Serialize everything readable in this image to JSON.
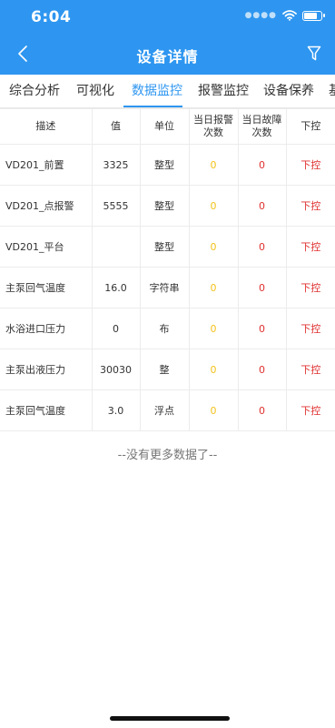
{
  "status": {
    "time": "6:04"
  },
  "nav": {
    "title": "设备详情"
  },
  "tabs": [
    "综合分析",
    "可视化",
    "数据监控",
    "报警监控",
    "设备保养",
    "基"
  ],
  "table": {
    "headers": [
      "描述",
      "值",
      "单位",
      "当日报警次数",
      "当日故障次数",
      "下控"
    ],
    "rows": [
      {
        "desc": "VD201_前置",
        "value": "3325",
        "unit": "整型",
        "alarm": "0",
        "fault": "0",
        "ctrl": "下控"
      },
      {
        "desc": "VD201_点报警",
        "value": "5555",
        "unit": "整型",
        "alarm": "0",
        "fault": "0",
        "ctrl": "下控"
      },
      {
        "desc": "VD201_平台",
        "value": "",
        "unit": "整型",
        "alarm": "0",
        "fault": "0",
        "ctrl": "下控"
      },
      {
        "desc": "主泵回气温度",
        "value": "16.0",
        "unit": "字符串",
        "alarm": "0",
        "fault": "0",
        "ctrl": "下控"
      },
      {
        "desc": "水浴进口压力",
        "value": "0",
        "unit": "布",
        "alarm": "0",
        "fault": "0",
        "ctrl": "下控"
      },
      {
        "desc": "主泵出液压力",
        "value": "30030",
        "unit": "整",
        "alarm": "0",
        "fault": "0",
        "ctrl": "下控"
      },
      {
        "desc": "主泵回气温度",
        "value": "3.0",
        "unit": "浮点",
        "alarm": "0",
        "fault": "0",
        "ctrl": "下控"
      }
    ]
  },
  "footer": {
    "no_more": "--没有更多数据了--"
  },
  "colors": {
    "primary": "#2e96f0",
    "warning_zero": "#f3c21a",
    "danger": "#e03030"
  }
}
